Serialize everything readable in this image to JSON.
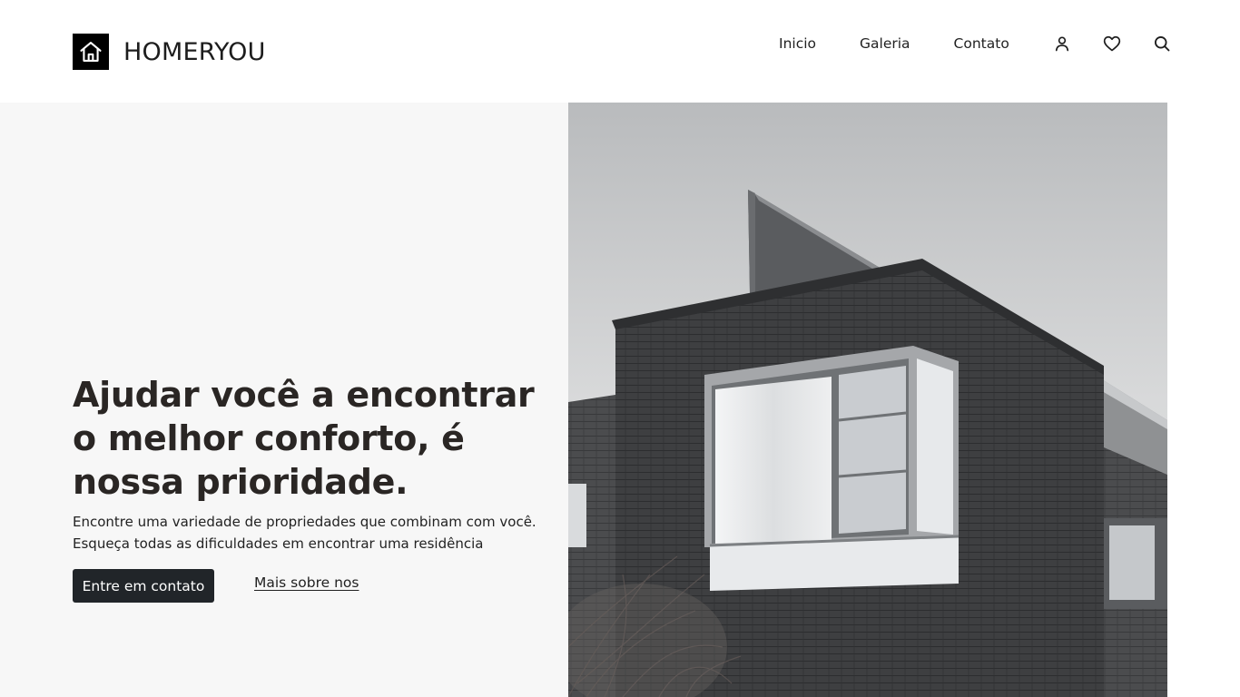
{
  "brand": {
    "name": "HOMERYOU",
    "logo_icon": "house-icon"
  },
  "nav": {
    "links": [
      "Inicio",
      "Galeria",
      "Contato"
    ],
    "icons": [
      "user-icon",
      "heart-icon",
      "search-icon"
    ]
  },
  "hero": {
    "title": "Ajudar você a encontrar o melhor conforto, é nossa prioridade.",
    "subtitle_line1": "Encontre uma variedade de propriedades que combinam com você.",
    "subtitle_line2": "Esqueça todas as dificuldades em encontrar uma residência",
    "primary_button": "Entre em contato",
    "secondary_link": "Mais sobre nos",
    "image": "modern-dark-brick-house-photo"
  },
  "colors": {
    "header_bg": "#ffffff",
    "hero_bg": "#f7f7f7",
    "button_bg": "#212529",
    "text_dark": "#2a2624"
  }
}
